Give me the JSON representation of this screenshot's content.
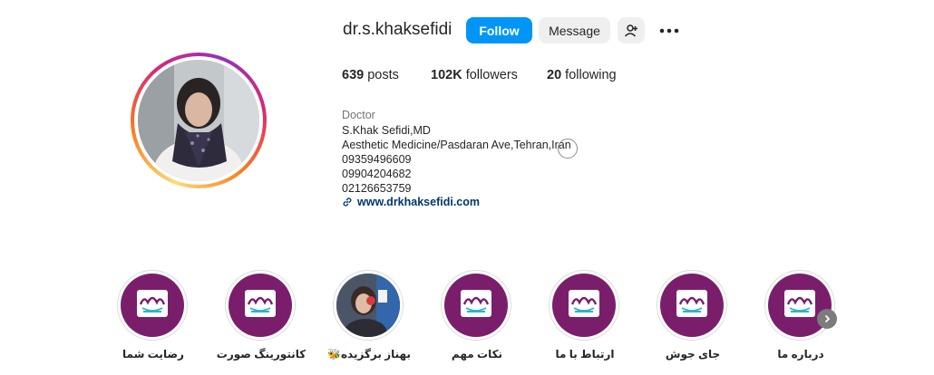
{
  "profile": {
    "username": "dr.s.khaksefidi",
    "follow_label": "Follow",
    "message_label": "Message",
    "add_user_icon": "person-add-icon",
    "more_icon": "more-horizontal-icon"
  },
  "stats": {
    "posts_count": "639",
    "posts_label": "posts",
    "followers_count": "102K",
    "followers_label": "followers",
    "following_count": "20",
    "following_label": "following"
  },
  "bio": {
    "category": "Doctor",
    "name": "S.Khak Sefidi,MD",
    "address": "Aesthetic Medicine/Pasdaran Ave,Tehran,Iran",
    "phone1": "09359496609",
    "phone2": "09904204682",
    "phone3": "02126653759",
    "link": "www.drkhaksefidi.com"
  },
  "highlights": [
    {
      "label": "رضایت شما",
      "kind": "logo"
    },
    {
      "label": "کانتورینگ صورت",
      "kind": "logo"
    },
    {
      "label": "بهناز برگزیده🐝",
      "kind": "photo"
    },
    {
      "label": "نکات مهم",
      "kind": "logo"
    },
    {
      "label": "ارتباط با ما",
      "kind": "logo"
    },
    {
      "label": "جای جوش",
      "kind": "logo"
    },
    {
      "label": "درباره ما",
      "kind": "logo"
    }
  ],
  "colors": {
    "follow_button": "#0095f6",
    "highlight_bg": "#7a1e6c",
    "link": "#00376b"
  }
}
